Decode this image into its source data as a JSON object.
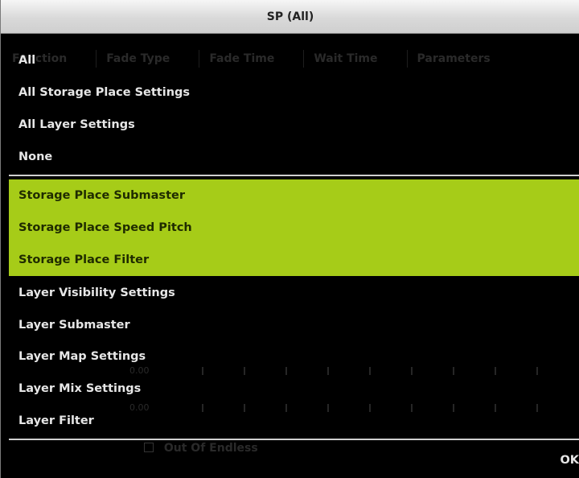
{
  "dialog": {
    "title": "SP (All)"
  },
  "background": {
    "columns": [
      "Function",
      "Fade Type",
      "Fade Time",
      "Wait Time",
      "Parameters"
    ],
    "scale_labels": [
      "0.00",
      "0.00"
    ],
    "footer_label": "Out Of Endless"
  },
  "menu": {
    "group1": [
      "All",
      "All Storage Place Settings",
      "All Layer Settings",
      "None"
    ],
    "group2": [
      "Storage Place Submaster",
      "Storage Place Speed Pitch",
      "Storage Place Filter"
    ],
    "group3": [
      "Layer Visibility Settings",
      "Layer Submaster",
      "Layer Map Settings",
      "Layer Mix Settings",
      "Layer Filter"
    ],
    "highlight_color": "#a6cc18"
  },
  "footer": {
    "ok_label": "OK"
  }
}
